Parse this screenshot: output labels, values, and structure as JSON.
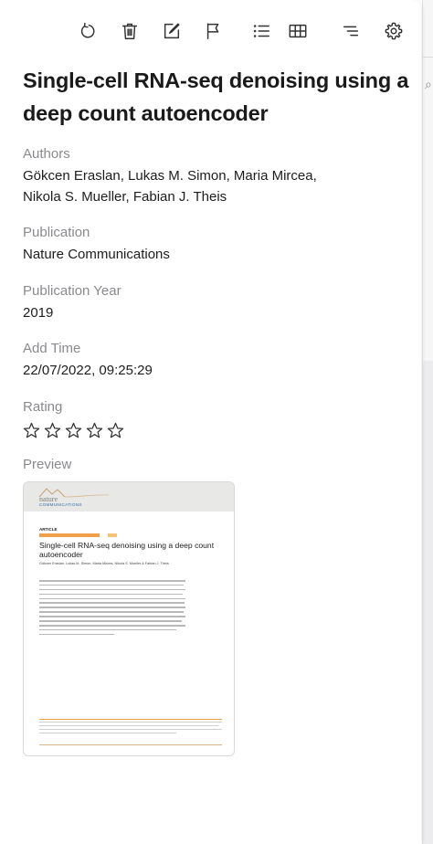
{
  "toolbar": {
    "buttons": [
      {
        "name": "refresh",
        "icon": "refresh-icon"
      },
      {
        "name": "delete",
        "icon": "trash-icon"
      },
      {
        "name": "edit",
        "icon": "edit-icon"
      },
      {
        "name": "flag",
        "icon": "flag-icon"
      },
      {
        "name": "list",
        "icon": "list-icon"
      },
      {
        "name": "table",
        "icon": "table-icon"
      },
      {
        "name": "sort",
        "icon": "sort-lines-icon"
      },
      {
        "name": "settings",
        "icon": "gear-icon"
      }
    ]
  },
  "paper": {
    "title": "Single-cell RNA-seq denoising using a deep count autoencoder",
    "authors_label": "Authors",
    "authors_line1": "Gökcen Eraslan, Lukas M. Simon, Maria Mircea,",
    "authors_line2": "Nikola S. Mueller, Fabian J. Theis",
    "publication_label": "Publication",
    "publication": "Nature Communications",
    "year_label": "Publication Year",
    "year": "2019",
    "addtime_label": "Add Time",
    "addtime": "22/07/2022, 09:25:29",
    "rating_label": "Rating",
    "rating": 0,
    "rating_max": 5,
    "preview_label": "Preview"
  },
  "preview": {
    "logo_top": "nature",
    "logo_bottom": "COMMUNICATIONS",
    "article_tag": "ARTICLE",
    "title": "Single-cell RNA-seq denoising using a deep count autoencoder",
    "authors": "Gökcen Eraslan, Lukas M. Simon, Maria Mircea, Nikola S. Mueller & Fabian J. Theis"
  }
}
